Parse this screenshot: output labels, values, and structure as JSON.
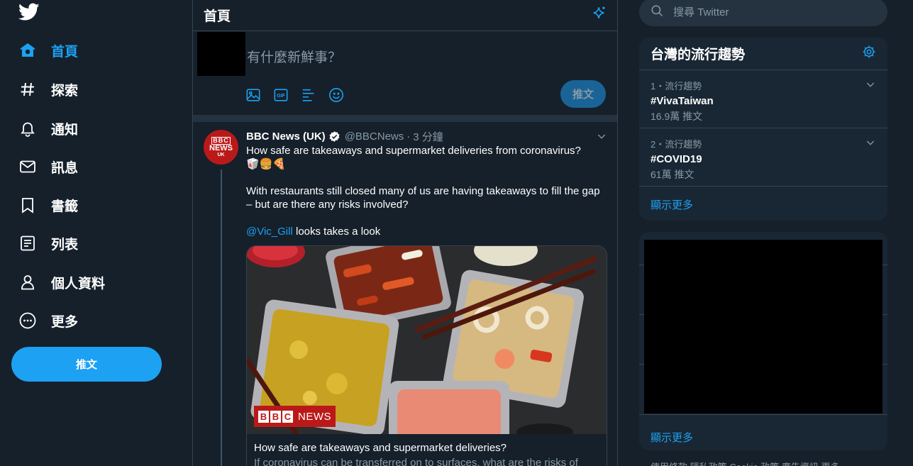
{
  "nav": {
    "logo_icon": "twitter-bird-icon",
    "items": [
      {
        "label": "首頁",
        "icon": "home-icon",
        "active": true
      },
      {
        "label": "探索",
        "icon": "hashtag-icon"
      },
      {
        "label": "通知",
        "icon": "bell-icon"
      },
      {
        "label": "訊息",
        "icon": "envelope-icon"
      },
      {
        "label": "書籤",
        "icon": "bookmark-icon"
      },
      {
        "label": "列表",
        "icon": "list-icon"
      },
      {
        "label": "個人資料",
        "icon": "person-icon"
      },
      {
        "label": "更多",
        "icon": "more-circle-icon"
      }
    ],
    "tweet_button": "推文"
  },
  "main": {
    "title": "首頁",
    "header_icon": "sparkle-icon",
    "composer": {
      "placeholder": "有什麼新鮮事？",
      "tools": [
        "image-icon",
        "gif-icon",
        "poll-icon",
        "emoji-icon"
      ],
      "send_label": "推文"
    },
    "tweet": {
      "author_name": "BBC News (UK)",
      "handle": "@BBCNews",
      "separator": "·",
      "time": "3 分鐘",
      "avatar": {
        "line1": "BBC",
        "line2": "NEWS",
        "line3": "UK"
      },
      "line1": "How safe are takeaways and supermarket deliveries from coronavirus?",
      "emojis": "🥡🍔🍕",
      "para2": "With restaurants still closed many of us are having takeaways to fill the gap – but are there any risks involved?",
      "mention": "@Vic_Gill",
      "para3_rest": " looks takes a look",
      "card": {
        "logo_b1": "B",
        "logo_b2": "B",
        "logo_b3": "C",
        "logo_news": "NEWS",
        "title": "How safe are takeaways and supermarket deliveries?",
        "description": "If coronavirus can be transferred on to surfaces, what are the risks of"
      }
    }
  },
  "right": {
    "search_placeholder": "搜尋 Twitter",
    "trends": {
      "title": "台灣的流行趨勢",
      "items": [
        {
          "meta": "1・流行趨勢",
          "tag": "#VivaTaiwan",
          "count": "16.9萬 推文"
        },
        {
          "meta": "2・流行趨勢",
          "tag": "#COVID19",
          "count": "61萬 推文"
        }
      ],
      "show_more": "顯示更多"
    },
    "who_to_follow": {
      "show_more": "顯示更多"
    },
    "footer": "使用條款  隱私政策  Cookie 政策  廣告資訊  更多"
  },
  "colors": {
    "background": "#15202b",
    "accent": "#1da1f2",
    "panel": "#192734",
    "border": "#38444d",
    "muted": "#8899a6",
    "bbc_red": "#bb1919"
  }
}
